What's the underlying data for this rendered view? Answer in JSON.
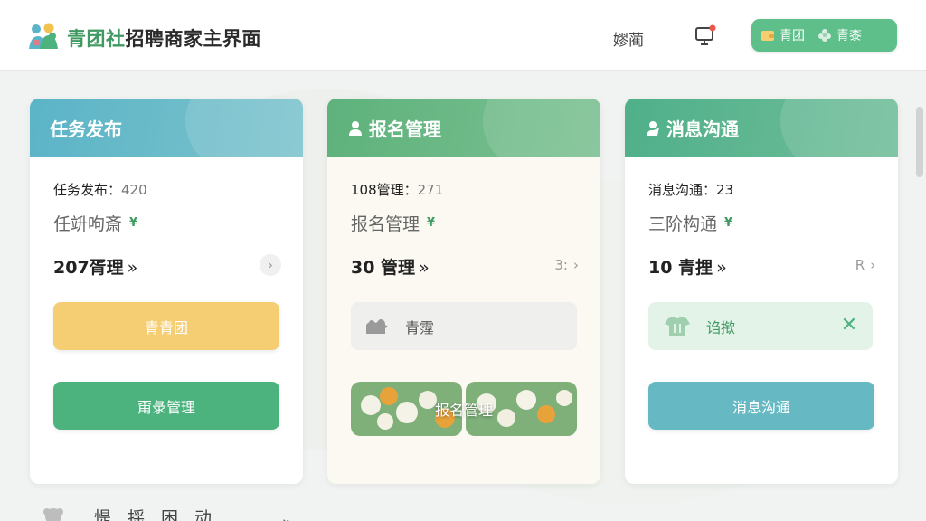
{
  "header": {
    "brand_accent": "青团社",
    "brand_rest": "招聘商家主界面",
    "user_name": "嫪蔺",
    "switcher": {
      "item1": "青团",
      "item2": "青桼"
    }
  },
  "cards": {
    "publish": {
      "title": "任务发布",
      "stat_label": "任务发布：",
      "stat_value": "420",
      "sub_text": "任竔呴斎",
      "yen": "¥",
      "count": "207胥理",
      "chevron": "»",
      "arrow": "›",
      "btn_primary": "青青团",
      "btn_secondary": "甭彔管理"
    },
    "signup": {
      "title": "报名管理",
      "stat_label": "108管理：",
      "stat_value": "271",
      "sub_text": "报名管理",
      "yen": "¥",
      "count": "30 管理",
      "chevron": "»",
      "extra": "3:",
      "arrow": "›",
      "field_text": "青霪",
      "img_btn": "报名管理"
    },
    "message": {
      "title": "消息沟通",
      "stat_label": "消息沟通：",
      "stat_value": "23",
      "sub_text": "三阶构通",
      "yen": "¥",
      "count": "10 青捚",
      "chevron": "»",
      "extra": "R",
      "arrow": "›",
      "chip_text": "诌揿",
      "chip_close": "✕",
      "btn": "消息沟通"
    }
  },
  "bottom": {
    "text": "惿揺困动",
    "chevron": "⌄"
  },
  "colors": {
    "brand_green": "#3f9a62",
    "card1_head": "#5bb4c7",
    "card2_head": "#5eb27c",
    "card3_head": "#4fb089",
    "yellow_btn": "#f5cd72",
    "green_btn": "#4cb37f",
    "teal_btn": "#66b9c2"
  }
}
